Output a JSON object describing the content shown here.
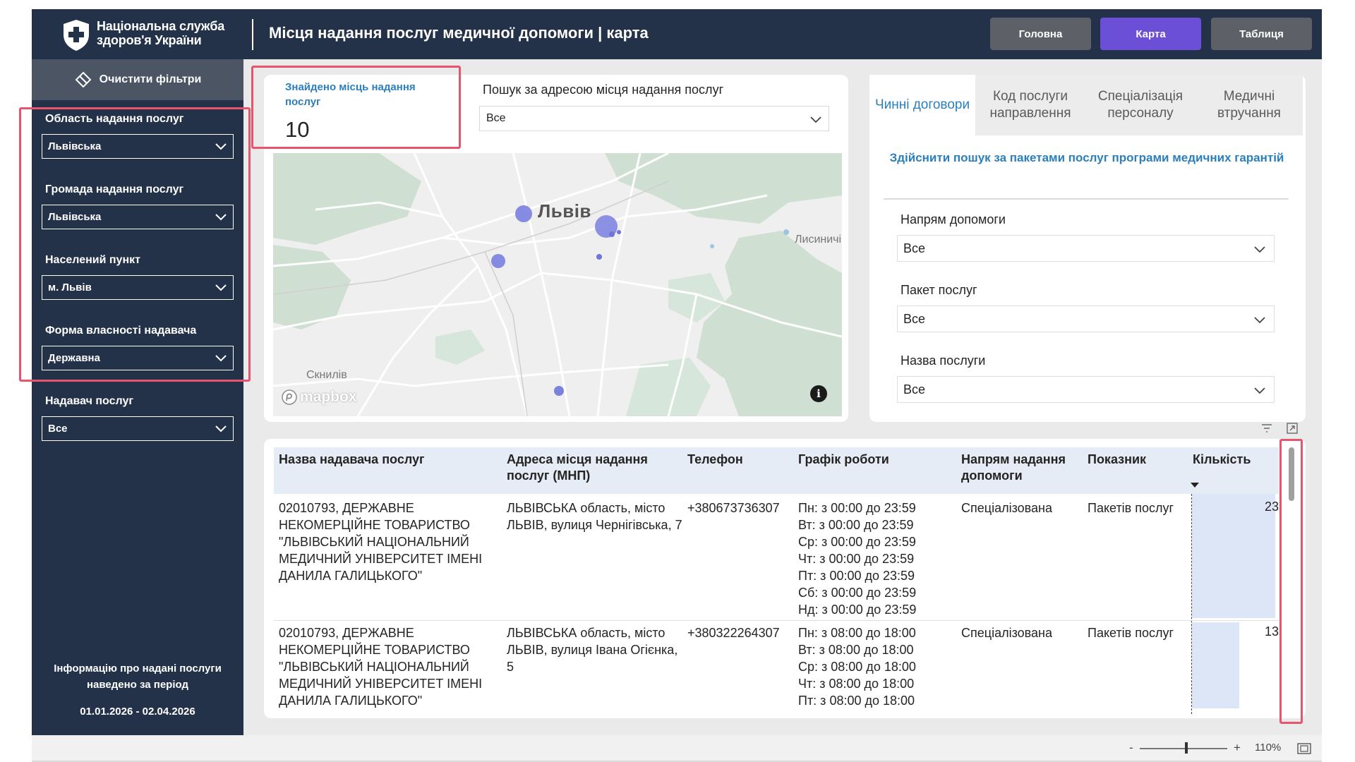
{
  "header": {
    "logo_line1": "Національна служба",
    "logo_line2": "здоров'я України",
    "title": "Місця надання послуг медичної допомоги | карта",
    "nav": [
      {
        "label": "Головна"
      },
      {
        "label": "Карта"
      },
      {
        "label": "Таблиця"
      }
    ],
    "active_nav": "Карта",
    "brand_color": "#233249",
    "accent_color": "#6b4fd6"
  },
  "sidebar": {
    "clear_filters": "Очистити фільтри",
    "filters": [
      {
        "label": "Область надання послуг",
        "value": "Львівська"
      },
      {
        "label": "Громада надання послуг",
        "value": "Львівська"
      },
      {
        "label": "Населений пункт",
        "value": "м. Львів"
      },
      {
        "label": "Форма власності надавача",
        "value": "Державна"
      },
      {
        "label": "Надавач послуг",
        "value": "Все"
      }
    ],
    "period_note": "Інформацію про надані послуги наведено за період",
    "period_dates": "01.01.2026 - 02.04.2026"
  },
  "found": {
    "label": "Знайдено місць надання послуг",
    "value": "10"
  },
  "address_search": {
    "label": "Пошук за адресою місця надання послуг",
    "value": "Все"
  },
  "map": {
    "city_label": "Львів",
    "labels": [
      "Лисиничі",
      "Скнилів"
    ],
    "attribution": "mapbox",
    "info_icon": "info-icon"
  },
  "tabs": [
    {
      "label": "Чинні договори",
      "active": true
    },
    {
      "label": "Код послуги направлення",
      "active": false
    },
    {
      "label": "Спеціалізація персоналу",
      "active": false
    },
    {
      "label": "Медичні втручання",
      "active": false
    }
  ],
  "packages": {
    "link": "Здійснити пошук за пакетами послуг програми медичних гарантій",
    "fields": [
      {
        "label": "Напрям допомоги",
        "value": "Все"
      },
      {
        "label": "Пакет послуг",
        "value": "Все"
      },
      {
        "label": "Назва послуги",
        "value": "Все"
      }
    ]
  },
  "table": {
    "columns": [
      "Назва надавача послуг",
      "Адреса місця надання послуг (МНП)",
      "Телефон",
      "Графік роботи",
      "Напрям надання допомоги",
      "Показник",
      "Кількість"
    ],
    "rows": [
      {
        "provider": "02010793, ДЕРЖАВНЕ НЕКОМЕРЦІЙНЕ ТОВАРИСТВО \"ЛЬВІВСЬКИЙ НАЦІОНАЛЬНИЙ МЕДИЧНИЙ УНІВЕРСИТЕТ ІМЕНІ ДАНИЛА ГАЛИЦЬКОГО\"",
        "address": "ЛЬВІВСЬКА область, місто ЛЬВІВ, вулиця Чернігівська, 7",
        "phone": "+380673736307",
        "schedule": [
          "Пн: з 00:00 до 23:59",
          "Вт: з 00:00 до 23:59",
          "Ср: з 00:00 до 23:59",
          "Чт: з 00:00 до 23:59",
          "Пт: з 00:00 до 23:59",
          "Сб: з 00:00 до 23:59",
          "Нд: з 00:00 до 23:59"
        ],
        "direction": "Спеціалізована",
        "indicator": "Пакетів послуг",
        "quantity": 23
      },
      {
        "provider": "02010793, ДЕРЖАВНЕ НЕКОМЕРЦІЙНЕ ТОВАРИСТВО \"ЛЬВІВСЬКИЙ НАЦІОНАЛЬНИЙ МЕДИЧНИЙ УНІВЕРСИТЕТ ІМЕНІ ДАНИЛА ГАЛИЦЬКОГО\"",
        "address": "ЛЬВІВСЬКА область, місто ЛЬВІВ, вулиця Івана Огієнка, 5",
        "phone": "+380322264307",
        "schedule": [
          "Пн: з 08:00 до 18:00",
          "Вт: з 08:00 до 18:00",
          "Ср: з 08:00 до 18:00",
          "Чт: з 08:00 до 18:00",
          "Пт: з 08:00 до 18:00"
        ],
        "direction": "Спеціалізована",
        "indicator": "Пакетів послуг",
        "quantity": 13
      }
    ],
    "bar_color": "#dde6f7"
  },
  "zoom": {
    "minus": "-",
    "plus": "+",
    "level": "110%"
  },
  "highlight_color": "#e8546e"
}
